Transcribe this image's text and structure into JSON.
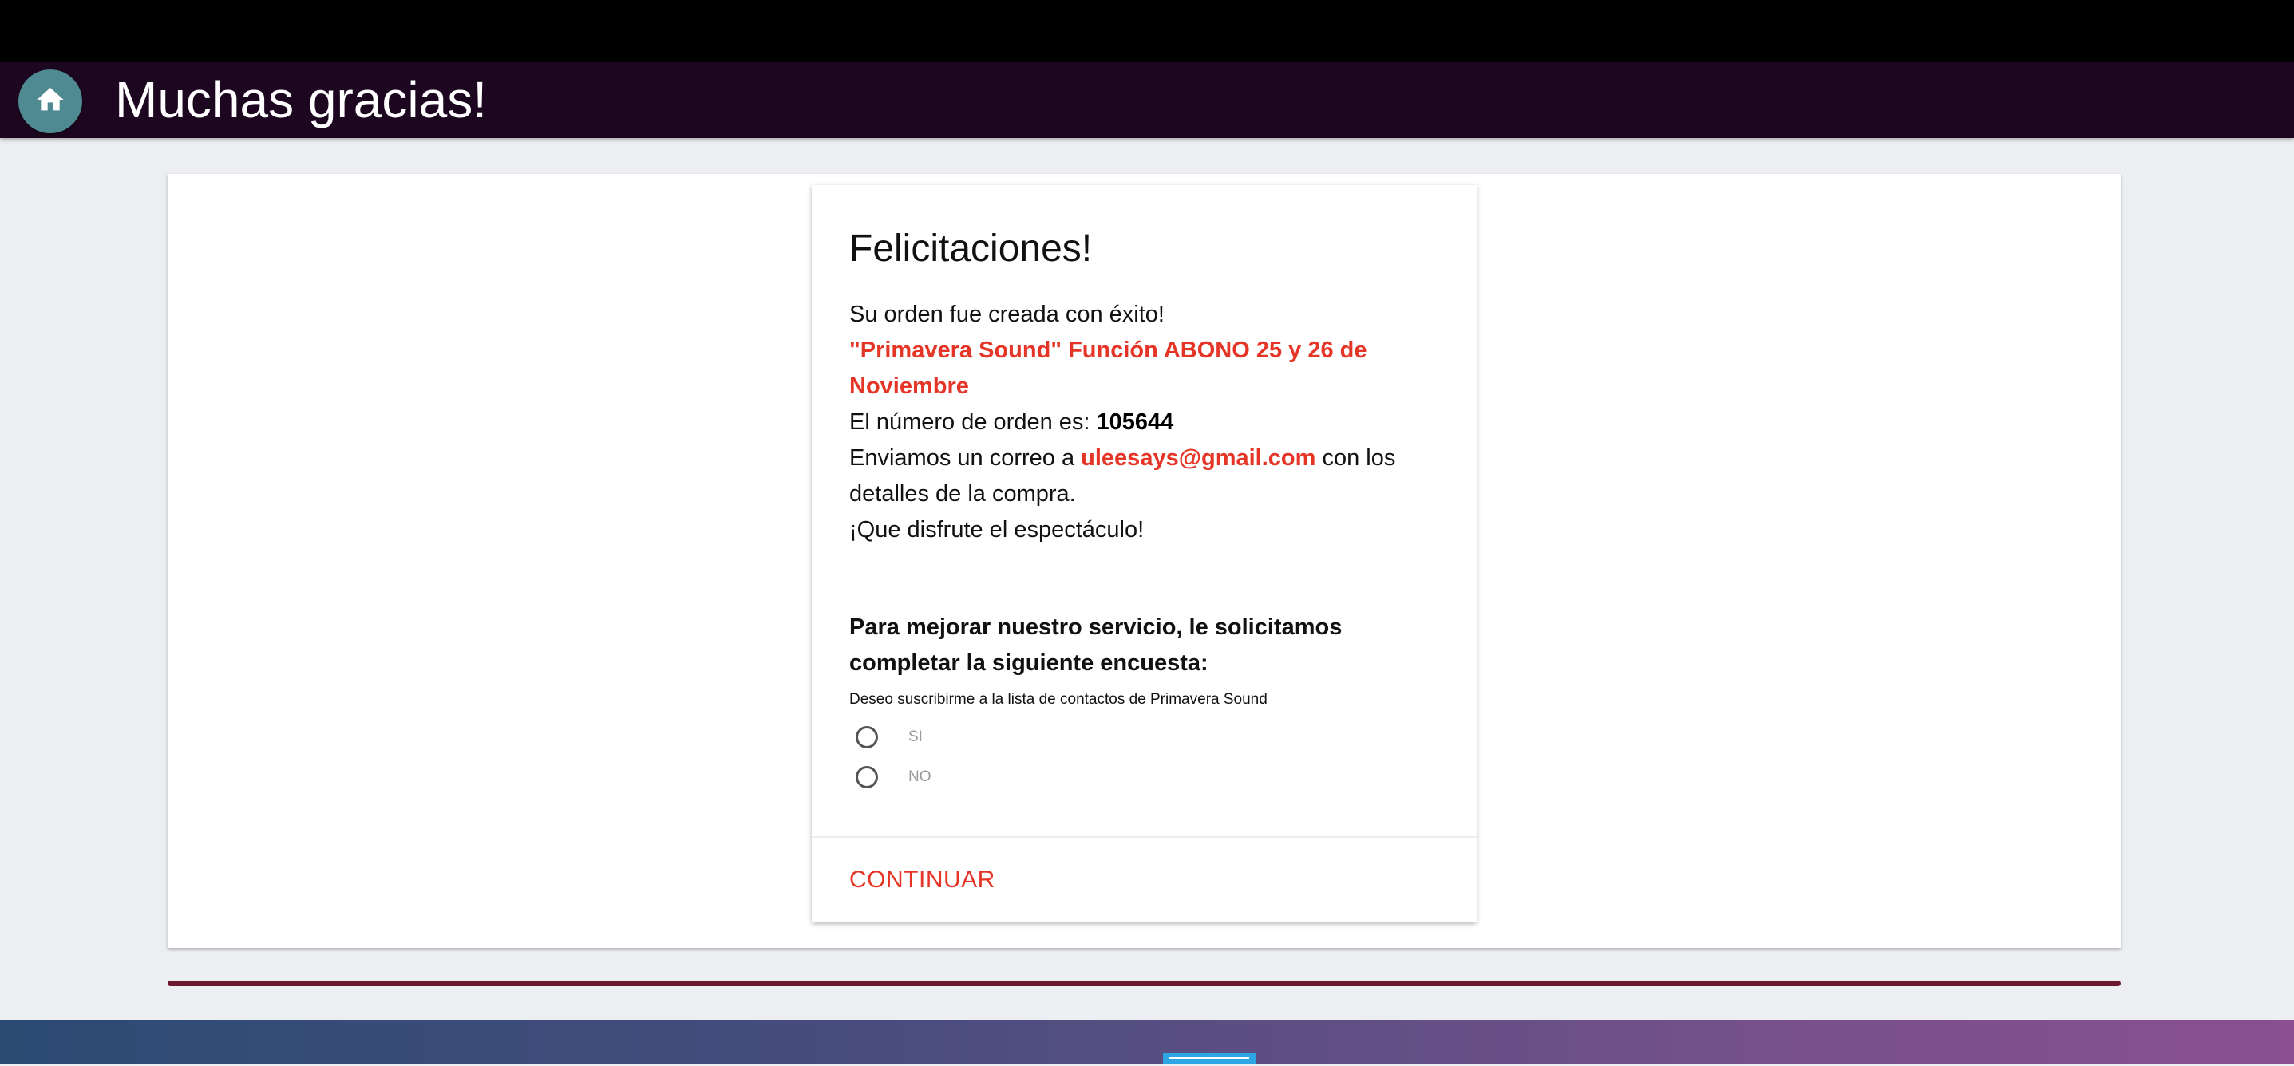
{
  "header": {
    "title": "Muchas gracias!",
    "home_icon": "home-icon",
    "background_color": "#1d0720",
    "home_button_color": "#4f8a92"
  },
  "card": {
    "title": "Felicitaciones!",
    "success_text": "Su orden fue creada con éxito!",
    "event_name": "\"Primavera Sound\" Función ABONO 25 y 26 de Noviembre",
    "order_label": "El número de orden es:",
    "order_number": "105644",
    "email_prefix": "Enviamos un correo a",
    "email": "uleesays@gmail.com",
    "email_suffix": "con los detalles de la compra.",
    "enjoy_text": "¡Que disfrute el espectáculo!",
    "survey_title": "Para mejorar nuestro servicio, le solicitamos completar la siguiente encuesta:",
    "survey_question": "Deseo suscribirme a la lista de contactos de Primavera Sound",
    "options": [
      {
        "label": "SI",
        "selected": false
      },
      {
        "label": "NO",
        "selected": false
      }
    ],
    "continue_label": "CONTINUAR"
  },
  "colors": {
    "accent": "#e53527",
    "divider_bar": "#6b1730",
    "footer_gradient_start": "#2b4b73",
    "footer_gradient_end": "#8a5090"
  }
}
